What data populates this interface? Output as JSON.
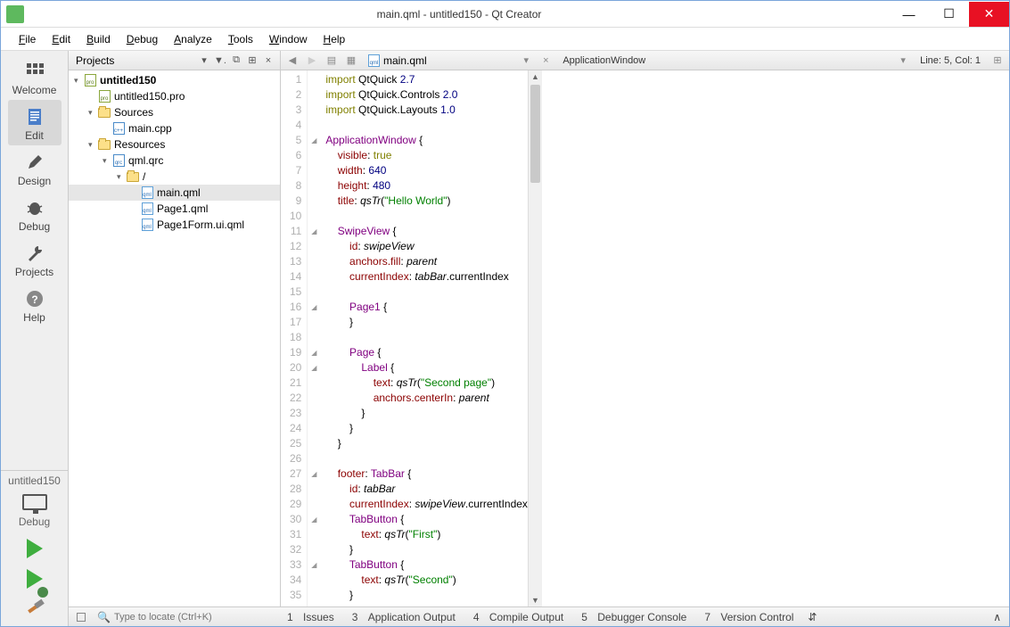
{
  "window": {
    "title": "main.qml - untitled150 - Qt Creator"
  },
  "menus": [
    "File",
    "Edit",
    "Build",
    "Debug",
    "Analyze",
    "Tools",
    "Window",
    "Help"
  ],
  "leftbar": {
    "items": [
      {
        "label": "Welcome"
      },
      {
        "label": "Edit"
      },
      {
        "label": "Design"
      },
      {
        "label": "Debug"
      },
      {
        "label": "Projects"
      },
      {
        "label": "Help"
      }
    ],
    "target": "untitled150",
    "config": "Debug"
  },
  "projects": {
    "selector": "Projects",
    "tree": [
      {
        "depth": 0,
        "expand": "▾",
        "icon": "pro",
        "label": "untitled150",
        "bold": true
      },
      {
        "depth": 1,
        "expand": "",
        "icon": "pro",
        "label": "untitled150.pro"
      },
      {
        "depth": 1,
        "expand": "▾",
        "icon": "folder",
        "label": "Sources"
      },
      {
        "depth": 2,
        "expand": "",
        "icon": "cpp",
        "label": "main.cpp"
      },
      {
        "depth": 1,
        "expand": "▾",
        "icon": "folder",
        "label": "Resources"
      },
      {
        "depth": 2,
        "expand": "▾",
        "icon": "qrc",
        "label": "qml.qrc"
      },
      {
        "depth": 3,
        "expand": "▾",
        "icon": "folder",
        "label": "/"
      },
      {
        "depth": 4,
        "expand": "",
        "icon": "qml",
        "label": "main.qml",
        "selected": true
      },
      {
        "depth": 4,
        "expand": "",
        "icon": "qml",
        "label": "Page1.qml"
      },
      {
        "depth": 4,
        "expand": "",
        "icon": "qml",
        "label": "Page1Form.ui.qml"
      }
    ]
  },
  "editor": {
    "file": "main.qml",
    "crumb": "ApplicationWindow",
    "status": "Line: 5, Col: 1",
    "lines": [
      {
        "n": 1,
        "fold": "",
        "tokens": [
          [
            "kw",
            "import"
          ],
          [
            "",
            " QtQuick "
          ],
          [
            "num",
            "2.7"
          ]
        ]
      },
      {
        "n": 2,
        "fold": "",
        "tokens": [
          [
            "kw",
            "import"
          ],
          [
            "",
            " QtQuick.Controls "
          ],
          [
            "num",
            "2.0"
          ]
        ]
      },
      {
        "n": 3,
        "fold": "",
        "tokens": [
          [
            "kw",
            "import"
          ],
          [
            "",
            " QtQuick.Layouts "
          ],
          [
            "num",
            "1.0"
          ]
        ]
      },
      {
        "n": 4,
        "fold": "",
        "tokens": [
          [
            "",
            ""
          ]
        ]
      },
      {
        "n": 5,
        "fold": "◢",
        "tokens": [
          [
            "type",
            "ApplicationWindow"
          ],
          [
            "",
            " {"
          ]
        ]
      },
      {
        "n": 6,
        "fold": "",
        "tokens": [
          [
            "",
            "    "
          ],
          [
            "prop",
            "visible"
          ],
          [
            "",
            ": "
          ],
          [
            "kw",
            "true"
          ]
        ]
      },
      {
        "n": 7,
        "fold": "",
        "tokens": [
          [
            "",
            "    "
          ],
          [
            "prop",
            "width"
          ],
          [
            "",
            ": "
          ],
          [
            "num",
            "640"
          ]
        ]
      },
      {
        "n": 8,
        "fold": "",
        "tokens": [
          [
            "",
            "    "
          ],
          [
            "prop",
            "height"
          ],
          [
            "",
            ": "
          ],
          [
            "num",
            "480"
          ]
        ]
      },
      {
        "n": 9,
        "fold": "",
        "tokens": [
          [
            "",
            "    "
          ],
          [
            "prop",
            "title"
          ],
          [
            "",
            ": "
          ],
          [
            "fn",
            "qsTr"
          ],
          [
            "",
            "("
          ],
          [
            "str",
            "\"Hello World\""
          ],
          [
            "",
            ")"
          ]
        ]
      },
      {
        "n": 10,
        "fold": "",
        "tokens": [
          [
            "",
            ""
          ]
        ]
      },
      {
        "n": 11,
        "fold": "◢",
        "tokens": [
          [
            "",
            "    "
          ],
          [
            "type",
            "SwipeView"
          ],
          [
            "",
            " {"
          ]
        ]
      },
      {
        "n": 12,
        "fold": "",
        "tokens": [
          [
            "",
            "        "
          ],
          [
            "prop",
            "id"
          ],
          [
            "",
            ": "
          ],
          [
            "ident",
            "swipeView"
          ]
        ]
      },
      {
        "n": 13,
        "fold": "",
        "tokens": [
          [
            "",
            "        "
          ],
          [
            "prop",
            "anchors.fill"
          ],
          [
            "",
            ": "
          ],
          [
            "ident",
            "parent"
          ]
        ]
      },
      {
        "n": 14,
        "fold": "",
        "tokens": [
          [
            "",
            "        "
          ],
          [
            "prop",
            "currentIndex"
          ],
          [
            "",
            ": "
          ],
          [
            "ident",
            "tabBar"
          ],
          [
            "",
            ".currentIndex"
          ]
        ]
      },
      {
        "n": 15,
        "fold": "",
        "tokens": [
          [
            "",
            ""
          ]
        ]
      },
      {
        "n": 16,
        "fold": "◢",
        "tokens": [
          [
            "",
            "        "
          ],
          [
            "type",
            "Page1"
          ],
          [
            "",
            " {"
          ]
        ]
      },
      {
        "n": 17,
        "fold": "",
        "tokens": [
          [
            "",
            "        }"
          ]
        ]
      },
      {
        "n": 18,
        "fold": "",
        "tokens": [
          [
            "",
            ""
          ]
        ]
      },
      {
        "n": 19,
        "fold": "◢",
        "tokens": [
          [
            "",
            "        "
          ],
          [
            "type",
            "Page"
          ],
          [
            "",
            " {"
          ]
        ]
      },
      {
        "n": 20,
        "fold": "◢",
        "tokens": [
          [
            "",
            "            "
          ],
          [
            "type",
            "Label"
          ],
          [
            "",
            " {"
          ]
        ]
      },
      {
        "n": 21,
        "fold": "",
        "tokens": [
          [
            "",
            "                "
          ],
          [
            "prop",
            "text"
          ],
          [
            "",
            ": "
          ],
          [
            "fn",
            "qsTr"
          ],
          [
            "",
            "("
          ],
          [
            "str",
            "\"Second page\""
          ],
          [
            "",
            ")"
          ]
        ]
      },
      {
        "n": 22,
        "fold": "",
        "tokens": [
          [
            "",
            "                "
          ],
          [
            "prop",
            "anchors.centerIn"
          ],
          [
            "",
            ": "
          ],
          [
            "ident",
            "parent"
          ]
        ]
      },
      {
        "n": 23,
        "fold": "",
        "tokens": [
          [
            "",
            "            }"
          ]
        ]
      },
      {
        "n": 24,
        "fold": "",
        "tokens": [
          [
            "",
            "        }"
          ]
        ]
      },
      {
        "n": 25,
        "fold": "",
        "tokens": [
          [
            "",
            "    }"
          ]
        ]
      },
      {
        "n": 26,
        "fold": "",
        "tokens": [
          [
            "",
            ""
          ]
        ]
      },
      {
        "n": 27,
        "fold": "◢",
        "tokens": [
          [
            "",
            "    "
          ],
          [
            "prop",
            "footer"
          ],
          [
            "",
            ": "
          ],
          [
            "type",
            "TabBar"
          ],
          [
            "",
            " {"
          ]
        ]
      },
      {
        "n": 28,
        "fold": "",
        "tokens": [
          [
            "",
            "        "
          ],
          [
            "prop",
            "id"
          ],
          [
            "",
            ": "
          ],
          [
            "ident",
            "tabBar"
          ]
        ]
      },
      {
        "n": 29,
        "fold": "",
        "tokens": [
          [
            "",
            "        "
          ],
          [
            "prop",
            "currentIndex"
          ],
          [
            "",
            ": "
          ],
          [
            "ident",
            "swipeView"
          ],
          [
            "",
            ".currentIndex"
          ]
        ]
      },
      {
        "n": 30,
        "fold": "◢",
        "tokens": [
          [
            "",
            "        "
          ],
          [
            "type",
            "TabButton"
          ],
          [
            "",
            " {"
          ]
        ]
      },
      {
        "n": 31,
        "fold": "",
        "tokens": [
          [
            "",
            "            "
          ],
          [
            "prop",
            "text"
          ],
          [
            "",
            ": "
          ],
          [
            "fn",
            "qsTr"
          ],
          [
            "",
            "("
          ],
          [
            "str",
            "\"First\""
          ],
          [
            "",
            ")"
          ]
        ]
      },
      {
        "n": 32,
        "fold": "",
        "tokens": [
          [
            "",
            "        }"
          ]
        ]
      },
      {
        "n": 33,
        "fold": "◢",
        "tokens": [
          [
            "",
            "        "
          ],
          [
            "type",
            "TabButton"
          ],
          [
            "",
            " {"
          ]
        ]
      },
      {
        "n": 34,
        "fold": "",
        "tokens": [
          [
            "",
            "            "
          ],
          [
            "prop",
            "text"
          ],
          [
            "",
            ": "
          ],
          [
            "fn",
            "qsTr"
          ],
          [
            "",
            "("
          ],
          [
            "str",
            "\"Second\""
          ],
          [
            "",
            ")"
          ]
        ]
      },
      {
        "n": 35,
        "fold": "",
        "tokens": [
          [
            "",
            "        }"
          ]
        ]
      }
    ]
  },
  "bottom": {
    "locator_placeholder": "Type to locate (Ctrl+K)",
    "panes": [
      {
        "num": "1",
        "label": "Issues"
      },
      {
        "num": "3",
        "label": "Application Output"
      },
      {
        "num": "4",
        "label": "Compile Output"
      },
      {
        "num": "5",
        "label": "Debugger Console"
      },
      {
        "num": "7",
        "label": "Version Control"
      }
    ]
  }
}
